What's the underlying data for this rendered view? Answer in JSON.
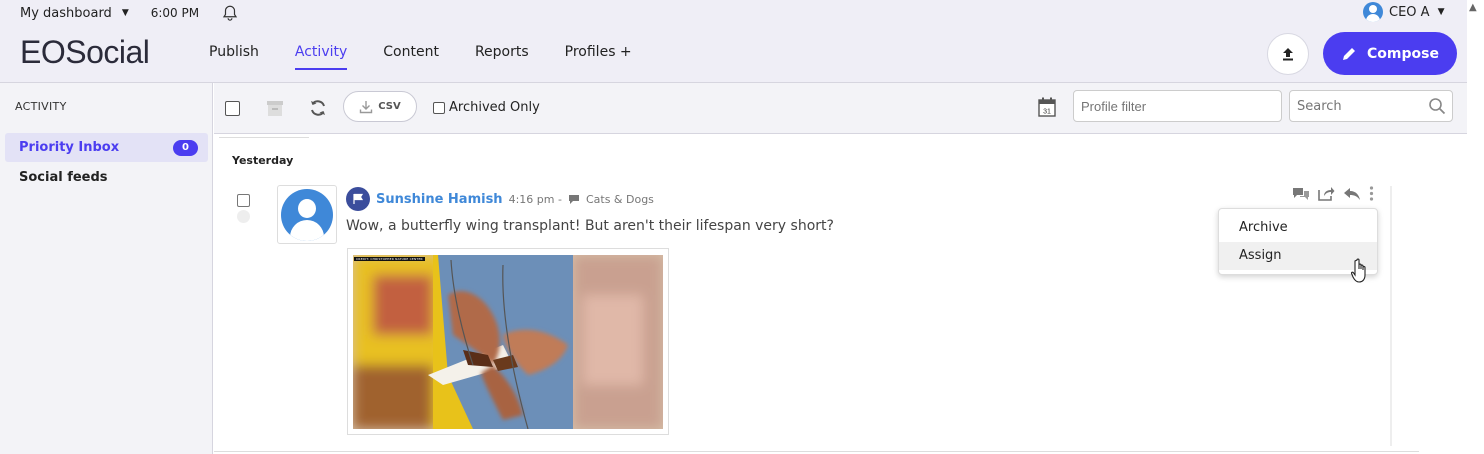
{
  "header": {
    "dashboard_label": "My dashboard",
    "time": "6:00 PM",
    "brand": "EOSocial",
    "nav": [
      {
        "label": "Publish",
        "active": false
      },
      {
        "label": "Activity",
        "active": true
      },
      {
        "label": "Content",
        "active": false
      },
      {
        "label": "Reports",
        "active": false
      },
      {
        "label": "Profiles +",
        "active": false
      }
    ],
    "user_name": "CEO A",
    "compose_label": "Compose",
    "accent_color": "#4b3df0"
  },
  "sidebar": {
    "heading": "ACTIVITY",
    "items": [
      {
        "label": "Priority Inbox",
        "badge": "0",
        "active": true
      },
      {
        "label": "Social feeds",
        "active": false
      }
    ]
  },
  "toolbar": {
    "csv_label": "CSV",
    "archived_only_label": "Archived Only",
    "profile_filter_placeholder": "Profile filter",
    "search_placeholder": "Search",
    "calendar_day": "31"
  },
  "feed": {
    "day_label": "Yesterday",
    "messages": [
      {
        "author": "Sunshine Hamish",
        "time": "4:16 pm -",
        "channel": "Cats & Dogs",
        "text": "Wow, a butterfly wing transplant! But aren't their lifespan very short?",
        "image_caption": "CREDIT: CHRISTOPHER NATURE CENTER"
      }
    ]
  },
  "context_menu": {
    "items": [
      {
        "label": "Archive",
        "hover": false
      },
      {
        "label": "Assign",
        "hover": true
      }
    ]
  }
}
